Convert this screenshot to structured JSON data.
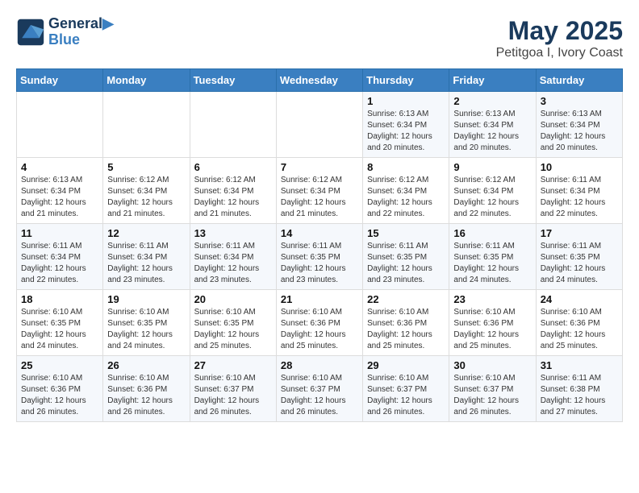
{
  "header": {
    "logo_line1": "General",
    "logo_line2": "Blue",
    "month": "May 2025",
    "location": "Petitgoa I, Ivory Coast"
  },
  "weekdays": [
    "Sunday",
    "Monday",
    "Tuesday",
    "Wednesday",
    "Thursday",
    "Friday",
    "Saturday"
  ],
  "weeks": [
    [
      {
        "day": "",
        "info": ""
      },
      {
        "day": "",
        "info": ""
      },
      {
        "day": "",
        "info": ""
      },
      {
        "day": "",
        "info": ""
      },
      {
        "day": "1",
        "info": "Sunrise: 6:13 AM\nSunset: 6:34 PM\nDaylight: 12 hours\nand 20 minutes."
      },
      {
        "day": "2",
        "info": "Sunrise: 6:13 AM\nSunset: 6:34 PM\nDaylight: 12 hours\nand 20 minutes."
      },
      {
        "day": "3",
        "info": "Sunrise: 6:13 AM\nSunset: 6:34 PM\nDaylight: 12 hours\nand 20 minutes."
      }
    ],
    [
      {
        "day": "4",
        "info": "Sunrise: 6:13 AM\nSunset: 6:34 PM\nDaylight: 12 hours\nand 21 minutes."
      },
      {
        "day": "5",
        "info": "Sunrise: 6:12 AM\nSunset: 6:34 PM\nDaylight: 12 hours\nand 21 minutes."
      },
      {
        "day": "6",
        "info": "Sunrise: 6:12 AM\nSunset: 6:34 PM\nDaylight: 12 hours\nand 21 minutes."
      },
      {
        "day": "7",
        "info": "Sunrise: 6:12 AM\nSunset: 6:34 PM\nDaylight: 12 hours\nand 21 minutes."
      },
      {
        "day": "8",
        "info": "Sunrise: 6:12 AM\nSunset: 6:34 PM\nDaylight: 12 hours\nand 22 minutes."
      },
      {
        "day": "9",
        "info": "Sunrise: 6:12 AM\nSunset: 6:34 PM\nDaylight: 12 hours\nand 22 minutes."
      },
      {
        "day": "10",
        "info": "Sunrise: 6:11 AM\nSunset: 6:34 PM\nDaylight: 12 hours\nand 22 minutes."
      }
    ],
    [
      {
        "day": "11",
        "info": "Sunrise: 6:11 AM\nSunset: 6:34 PM\nDaylight: 12 hours\nand 22 minutes."
      },
      {
        "day": "12",
        "info": "Sunrise: 6:11 AM\nSunset: 6:34 PM\nDaylight: 12 hours\nand 23 minutes."
      },
      {
        "day": "13",
        "info": "Sunrise: 6:11 AM\nSunset: 6:34 PM\nDaylight: 12 hours\nand 23 minutes."
      },
      {
        "day": "14",
        "info": "Sunrise: 6:11 AM\nSunset: 6:35 PM\nDaylight: 12 hours\nand 23 minutes."
      },
      {
        "day": "15",
        "info": "Sunrise: 6:11 AM\nSunset: 6:35 PM\nDaylight: 12 hours\nand 23 minutes."
      },
      {
        "day": "16",
        "info": "Sunrise: 6:11 AM\nSunset: 6:35 PM\nDaylight: 12 hours\nand 24 minutes."
      },
      {
        "day": "17",
        "info": "Sunrise: 6:11 AM\nSunset: 6:35 PM\nDaylight: 12 hours\nand 24 minutes."
      }
    ],
    [
      {
        "day": "18",
        "info": "Sunrise: 6:10 AM\nSunset: 6:35 PM\nDaylight: 12 hours\nand 24 minutes."
      },
      {
        "day": "19",
        "info": "Sunrise: 6:10 AM\nSunset: 6:35 PM\nDaylight: 12 hours\nand 24 minutes."
      },
      {
        "day": "20",
        "info": "Sunrise: 6:10 AM\nSunset: 6:35 PM\nDaylight: 12 hours\nand 25 minutes."
      },
      {
        "day": "21",
        "info": "Sunrise: 6:10 AM\nSunset: 6:36 PM\nDaylight: 12 hours\nand 25 minutes."
      },
      {
        "day": "22",
        "info": "Sunrise: 6:10 AM\nSunset: 6:36 PM\nDaylight: 12 hours\nand 25 minutes."
      },
      {
        "day": "23",
        "info": "Sunrise: 6:10 AM\nSunset: 6:36 PM\nDaylight: 12 hours\nand 25 minutes."
      },
      {
        "day": "24",
        "info": "Sunrise: 6:10 AM\nSunset: 6:36 PM\nDaylight: 12 hours\nand 25 minutes."
      }
    ],
    [
      {
        "day": "25",
        "info": "Sunrise: 6:10 AM\nSunset: 6:36 PM\nDaylight: 12 hours\nand 26 minutes."
      },
      {
        "day": "26",
        "info": "Sunrise: 6:10 AM\nSunset: 6:36 PM\nDaylight: 12 hours\nand 26 minutes."
      },
      {
        "day": "27",
        "info": "Sunrise: 6:10 AM\nSunset: 6:37 PM\nDaylight: 12 hours\nand 26 minutes."
      },
      {
        "day": "28",
        "info": "Sunrise: 6:10 AM\nSunset: 6:37 PM\nDaylight: 12 hours\nand 26 minutes."
      },
      {
        "day": "29",
        "info": "Sunrise: 6:10 AM\nSunset: 6:37 PM\nDaylight: 12 hours\nand 26 minutes."
      },
      {
        "day": "30",
        "info": "Sunrise: 6:10 AM\nSunset: 6:37 PM\nDaylight: 12 hours\nand 26 minutes."
      },
      {
        "day": "31",
        "info": "Sunrise: 6:11 AM\nSunset: 6:38 PM\nDaylight: 12 hours\nand 27 minutes."
      }
    ]
  ]
}
